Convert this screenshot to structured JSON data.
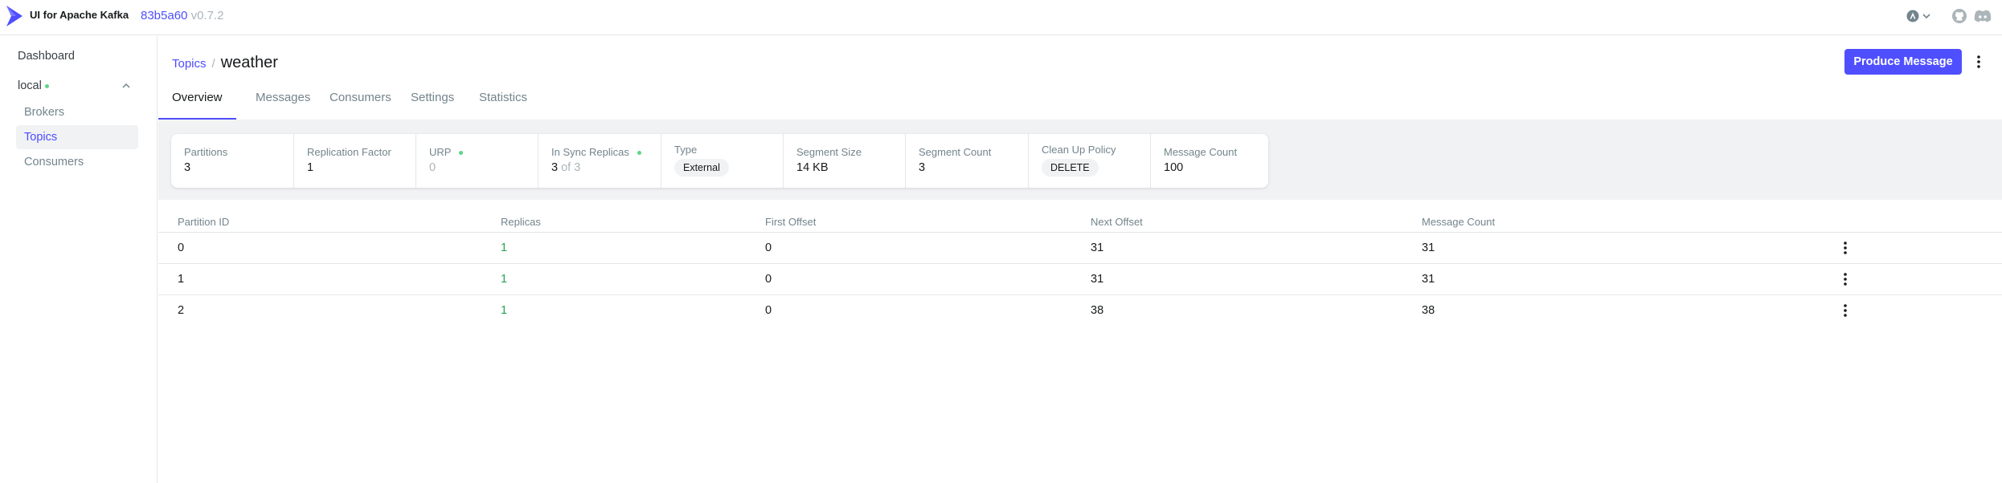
{
  "app": {
    "title": "UI for Apache Kafka",
    "commit_hash": "83b5a60",
    "version": "v0.7.2",
    "accent_color": "#4f4fff"
  },
  "navbar": {
    "icons": [
      "user-menu-icon",
      "github-icon",
      "discord-icon"
    ]
  },
  "sidebar": {
    "dashboard_label": "Dashboard",
    "cluster_name": "local",
    "cluster_status_color": "#5cd685",
    "items": [
      {
        "label": "Brokers",
        "active": false
      },
      {
        "label": "Topics",
        "active": true
      },
      {
        "label": "Consumers",
        "active": false
      }
    ]
  },
  "header": {
    "breadcrumb_parent": "Topics",
    "breadcrumb_separator": "/",
    "topic_name": "weather",
    "produce_button_label": "Produce Message"
  },
  "tabs": [
    {
      "label": "Overview",
      "active": true
    },
    {
      "label": "Messages",
      "active": false
    },
    {
      "label": "Consumers",
      "active": false
    },
    {
      "label": "Settings",
      "active": false
    },
    {
      "label": "Statistics",
      "active": false
    }
  ],
  "stats": {
    "partitions": {
      "label": "Partitions",
      "value": "3"
    },
    "replication_factor": {
      "label": "Replication Factor",
      "value": "1"
    },
    "urp": {
      "label": "URP",
      "value": "0"
    },
    "in_sync_replicas": {
      "label": "In Sync Replicas",
      "value": "3",
      "of_text": "of 3"
    },
    "type": {
      "label": "Type",
      "value": "External"
    },
    "segment_size": {
      "label": "Segment Size",
      "value": "14 KB"
    },
    "segment_count": {
      "label": "Segment Count",
      "value": "3"
    },
    "cleanup_policy": {
      "label": "Clean Up Policy",
      "value": "DELETE"
    },
    "message_count": {
      "label": "Message Count",
      "value": "100"
    }
  },
  "table": {
    "headers": [
      "Partition ID",
      "Replicas",
      "First Offset",
      "Next Offset",
      "Message Count"
    ],
    "rows": [
      [
        "0",
        "1",
        "0",
        "31",
        "31"
      ],
      [
        "1",
        "1",
        "0",
        "31",
        "31"
      ],
      [
        "2",
        "1",
        "0",
        "38",
        "38"
      ]
    ]
  }
}
